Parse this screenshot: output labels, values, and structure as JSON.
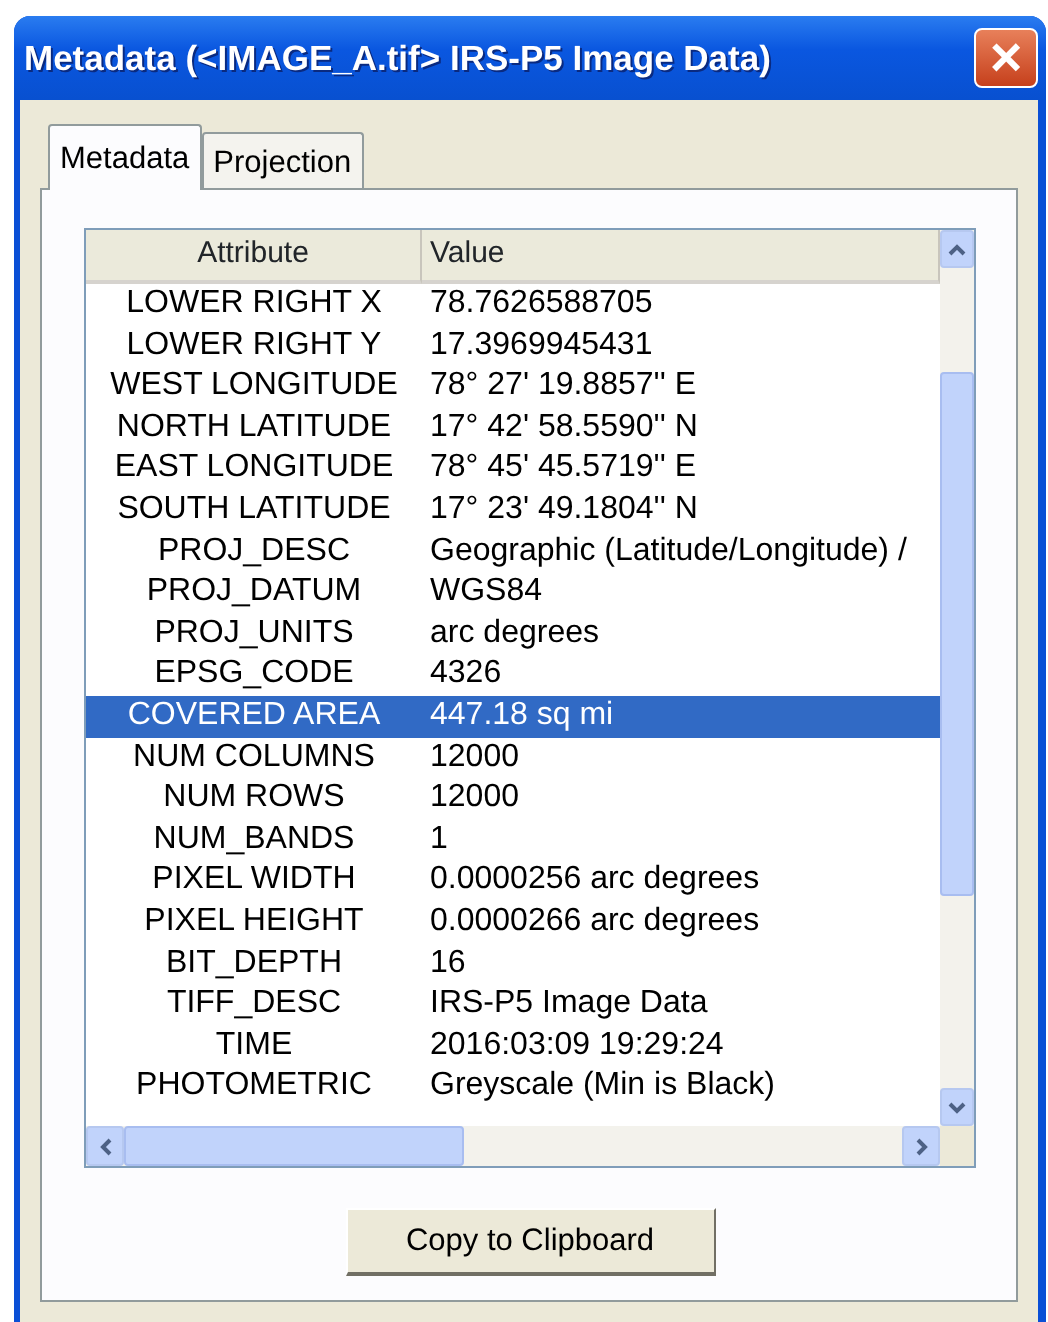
{
  "window": {
    "title": "Metadata (<IMAGE_A.tif> IRS-P5 Image Data)",
    "close": "×"
  },
  "tabs": [
    {
      "label": "Metadata",
      "selected": true
    },
    {
      "label": "Projection",
      "selected": false
    }
  ],
  "table": {
    "columns": [
      "Attribute",
      "Value"
    ],
    "rows": [
      {
        "attribute": "LOWER RIGHT X",
        "value": "78.7626588705",
        "selected": false
      },
      {
        "attribute": "LOWER RIGHT Y",
        "value": "17.3969945431",
        "selected": false
      },
      {
        "attribute": "WEST LONGITUDE",
        "value": "78° 27' 19.8857'' E",
        "selected": false
      },
      {
        "attribute": "NORTH LATITUDE",
        "value": "17° 42' 58.5590'' N",
        "selected": false
      },
      {
        "attribute": "EAST LONGITUDE",
        "value": "78° 45' 45.5719'' E",
        "selected": false
      },
      {
        "attribute": "SOUTH LATITUDE",
        "value": "17° 23' 49.1804'' N",
        "selected": false
      },
      {
        "attribute": "PROJ_DESC",
        "value": "Geographic (Latitude/Longitude) /",
        "selected": false
      },
      {
        "attribute": "PROJ_DATUM",
        "value": "WGS84",
        "selected": false
      },
      {
        "attribute": "PROJ_UNITS",
        "value": "arc degrees",
        "selected": false
      },
      {
        "attribute": "EPSG_CODE",
        "value": "4326",
        "selected": false
      },
      {
        "attribute": "COVERED AREA",
        "value": "447.18 sq mi",
        "selected": true
      },
      {
        "attribute": "NUM COLUMNS",
        "value": "12000",
        "selected": false
      },
      {
        "attribute": "NUM ROWS",
        "value": "12000",
        "selected": false
      },
      {
        "attribute": "NUM_BANDS",
        "value": "1",
        "selected": false
      },
      {
        "attribute": "PIXEL WIDTH",
        "value": "0.0000256 arc degrees",
        "selected": false
      },
      {
        "attribute": "PIXEL HEIGHT",
        "value": "0.0000266 arc degrees",
        "selected": false
      },
      {
        "attribute": "BIT_DEPTH",
        "value": "16",
        "selected": false
      },
      {
        "attribute": "TIFF_DESC",
        "value": "IRS-P5 Image Data",
        "selected": false
      },
      {
        "attribute": "TIME",
        "value": "2016:03:09 19:29:24",
        "selected": false
      },
      {
        "attribute": "PHOTOMETRIC",
        "value": "Greyscale (Min is Black)",
        "selected": false
      }
    ]
  },
  "buttons": [
    "Copy to Clipboard"
  ]
}
